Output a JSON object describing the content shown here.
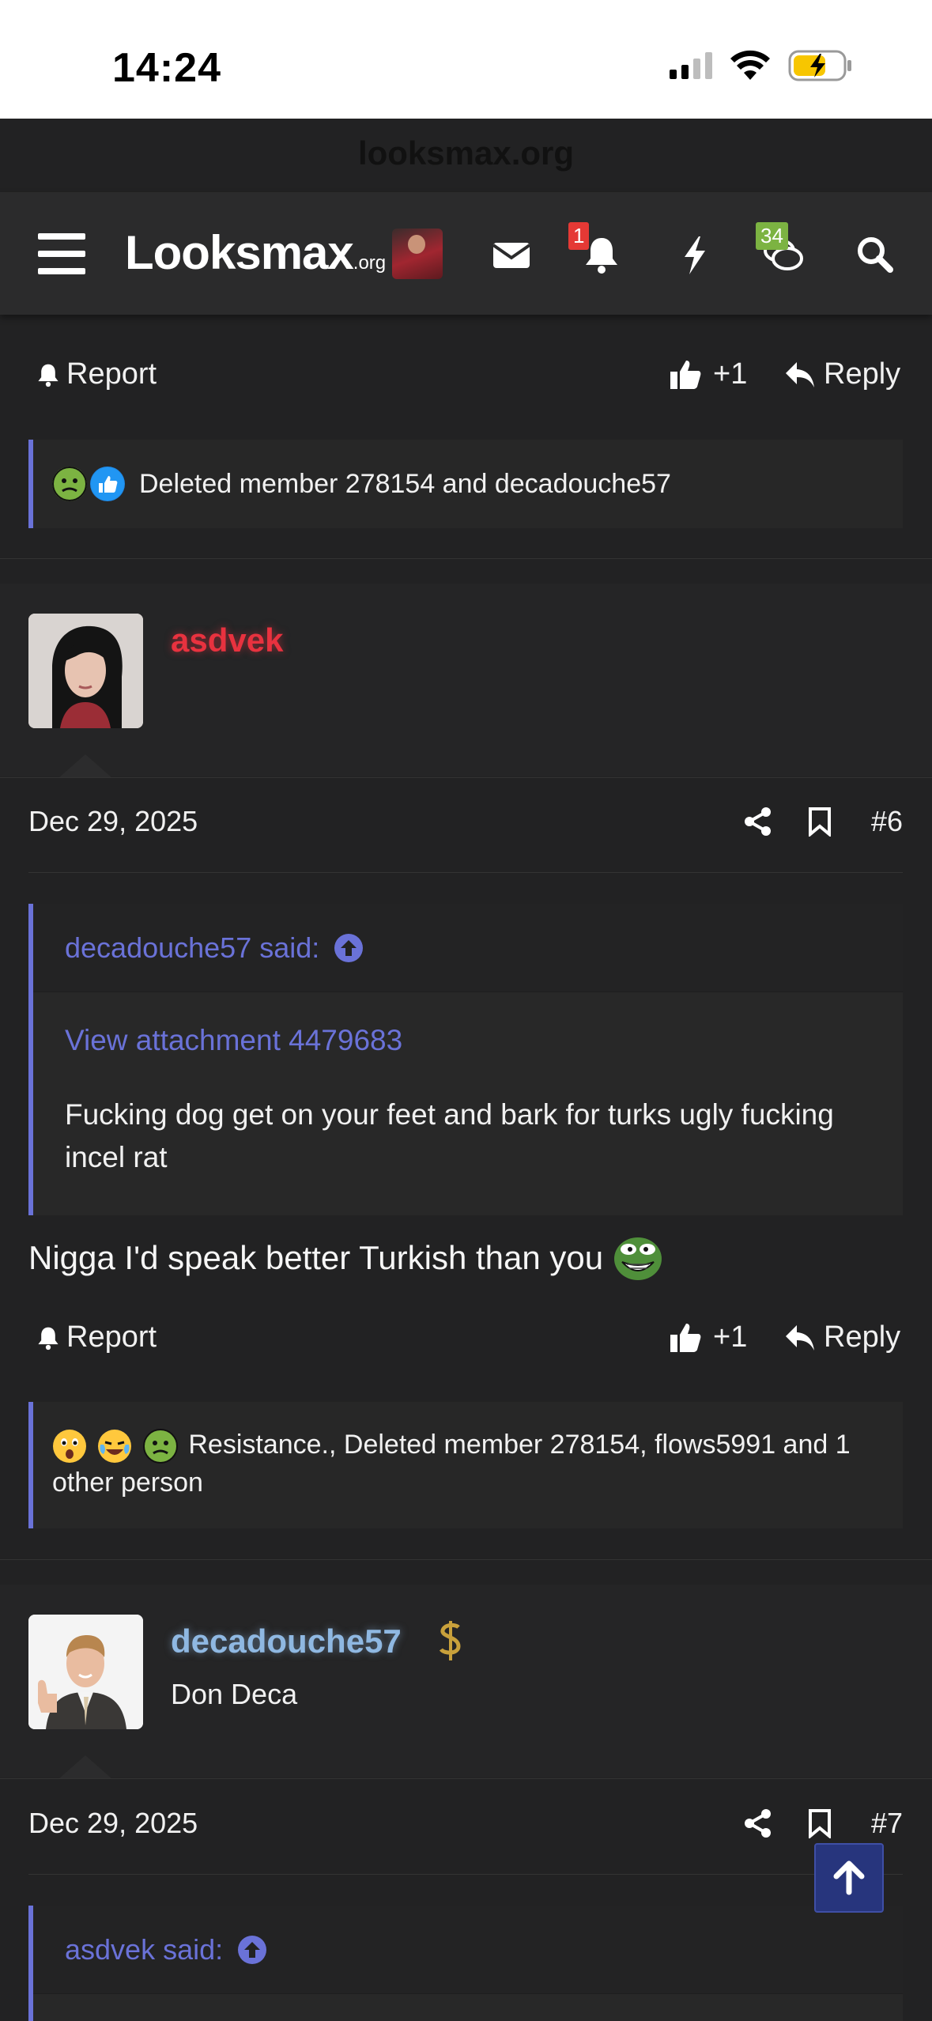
{
  "status_bar": {
    "time": "14:24"
  },
  "browser": {
    "url": "looksmax.org"
  },
  "nav": {
    "logo_main": "Looksmax",
    "logo_suffix": ".org",
    "alerts_badge": "1",
    "conversations_badge": "34",
    "colors": {
      "alert_badge": "#e53935",
      "conv_badge": "#7cb342"
    }
  },
  "post5": {
    "report_label": "Report",
    "like_count": "+1",
    "reply_label": "Reply",
    "reactions_text": "Deleted member 278154 and decadouche57"
  },
  "post6": {
    "username": "asdvek",
    "date": "Dec 29, 2025",
    "number": "#6",
    "quote": {
      "author": "decadouche57 said:",
      "attachment": "View attachment 4479683",
      "text": "Fucking dog get on your feet and bark for turks ugly fucking incel rat"
    },
    "message": "Nigga I'd speak better Turkish than you",
    "report_label": "Report",
    "like_count": "+1",
    "reply_label": "Reply",
    "reactions_text": "Resistance., Deleted member 278154, flows5991 and 1 other person",
    "colors": {
      "username": "#e8323f"
    }
  },
  "post7": {
    "username": "decadouche57",
    "user_title": "Don Deca",
    "date": "Dec 29, 2025",
    "number": "#7",
    "quote": {
      "author": "asdvek said:"
    },
    "colors": {
      "username": "#8fb8e2"
    }
  },
  "icons": [
    "hamburger-icon",
    "envelope-icon",
    "bell-icon",
    "bolt-icon",
    "chat-icon",
    "search-icon",
    "share-icon",
    "bookmark-icon",
    "thumbs-up-icon",
    "reply-icon",
    "arrow-up-icon"
  ],
  "accent_color": "#6a72d8"
}
